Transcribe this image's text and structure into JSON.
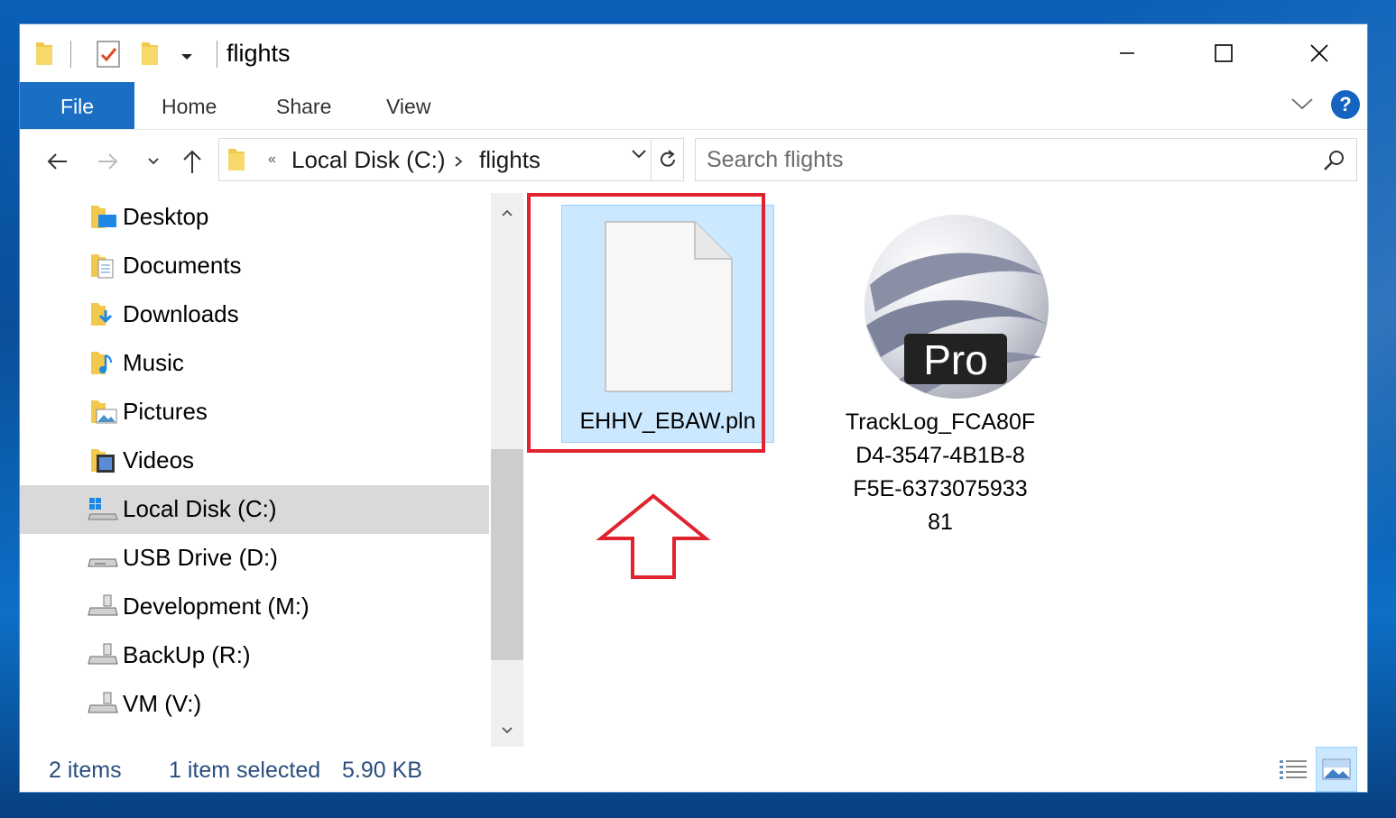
{
  "window": {
    "title": "flights"
  },
  "ribbon": {
    "tabs": [
      "File",
      "Home",
      "Share",
      "View"
    ],
    "help": "?"
  },
  "address": {
    "overflow": "«",
    "crumbs": [
      "Local Disk (C:)",
      "flights"
    ]
  },
  "search": {
    "placeholder": "Search flights"
  },
  "nav_pane": {
    "items": [
      {
        "label": "Desktop",
        "icon": "desktop-folder-icon"
      },
      {
        "label": "Documents",
        "icon": "documents-folder-icon"
      },
      {
        "label": "Downloads",
        "icon": "downloads-folder-icon"
      },
      {
        "label": "Music",
        "icon": "music-folder-icon"
      },
      {
        "label": "Pictures",
        "icon": "pictures-folder-icon"
      },
      {
        "label": "Videos",
        "icon": "videos-folder-icon"
      },
      {
        "label": "Local Disk (C:)",
        "icon": "system-drive-icon",
        "selected": true
      },
      {
        "label": "USB Drive (D:)",
        "icon": "usb-drive-icon"
      },
      {
        "label": "Development (M:)",
        "icon": "network-drive-icon"
      },
      {
        "label": "BackUp (R:)",
        "icon": "network-drive-icon"
      },
      {
        "label": "VM (V:)",
        "icon": "network-drive-icon"
      }
    ]
  },
  "files": [
    {
      "name": "EHHV_EBAW.pln",
      "icon": "blank-file-icon",
      "selected": true
    },
    {
      "name_lines": [
        "TrackLog_FCA80F",
        "D4-3547-4B1B-8",
        "F5E-6373075933",
        "81"
      ],
      "icon": "google-earth-pro-icon",
      "badge": "Pro"
    }
  ],
  "status": {
    "count": "2 items",
    "selection": "1 item selected",
    "size": "5.90 KB"
  },
  "colors": {
    "accent": "#1a6fc4",
    "selection": "#cce8ff",
    "highlight": "#e0232e"
  }
}
